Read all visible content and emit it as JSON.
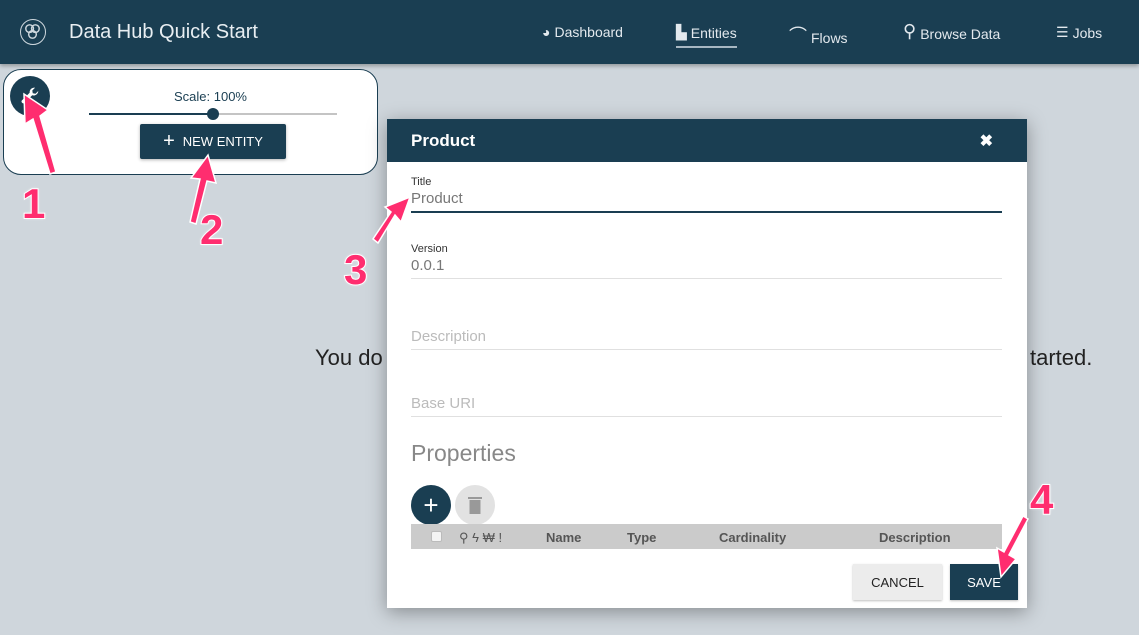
{
  "header": {
    "title": "Data Hub Quick Start",
    "nav": [
      {
        "label": "Dashboard",
        "icon": "dashboard-icon"
      },
      {
        "label": "Entities",
        "icon": "factory-icon",
        "active": true
      },
      {
        "label": "Flows",
        "icon": "rainbow-icon"
      },
      {
        "label": "Browse Data",
        "icon": "search-icon"
      },
      {
        "label": "Jobs",
        "icon": "list-icon"
      }
    ]
  },
  "toolbox": {
    "scale_label": "Scale: 100%",
    "scale_value": 100,
    "new_entity_label": "NEW ENTITY"
  },
  "background_message": {
    "left_fragment": "You do",
    "right_fragment": "tarted."
  },
  "modal": {
    "title": "Product",
    "fields": {
      "title_label": "Title",
      "title_value": "Product",
      "version_label": "Version",
      "version_value": "0.0.1",
      "description_placeholder": "Description",
      "base_uri_placeholder": "Base URI"
    },
    "properties_heading": "Properties",
    "columns": [
      "Name",
      "Type",
      "Cardinality",
      "Description"
    ],
    "cancel_label": "CANCEL",
    "save_label": "SAVE"
  },
  "annotations": [
    "1",
    "2",
    "3",
    "4"
  ],
  "colors": {
    "primary": "#1a3e52",
    "annotation": "#ff2d6f",
    "background": "#cfd6dc"
  }
}
